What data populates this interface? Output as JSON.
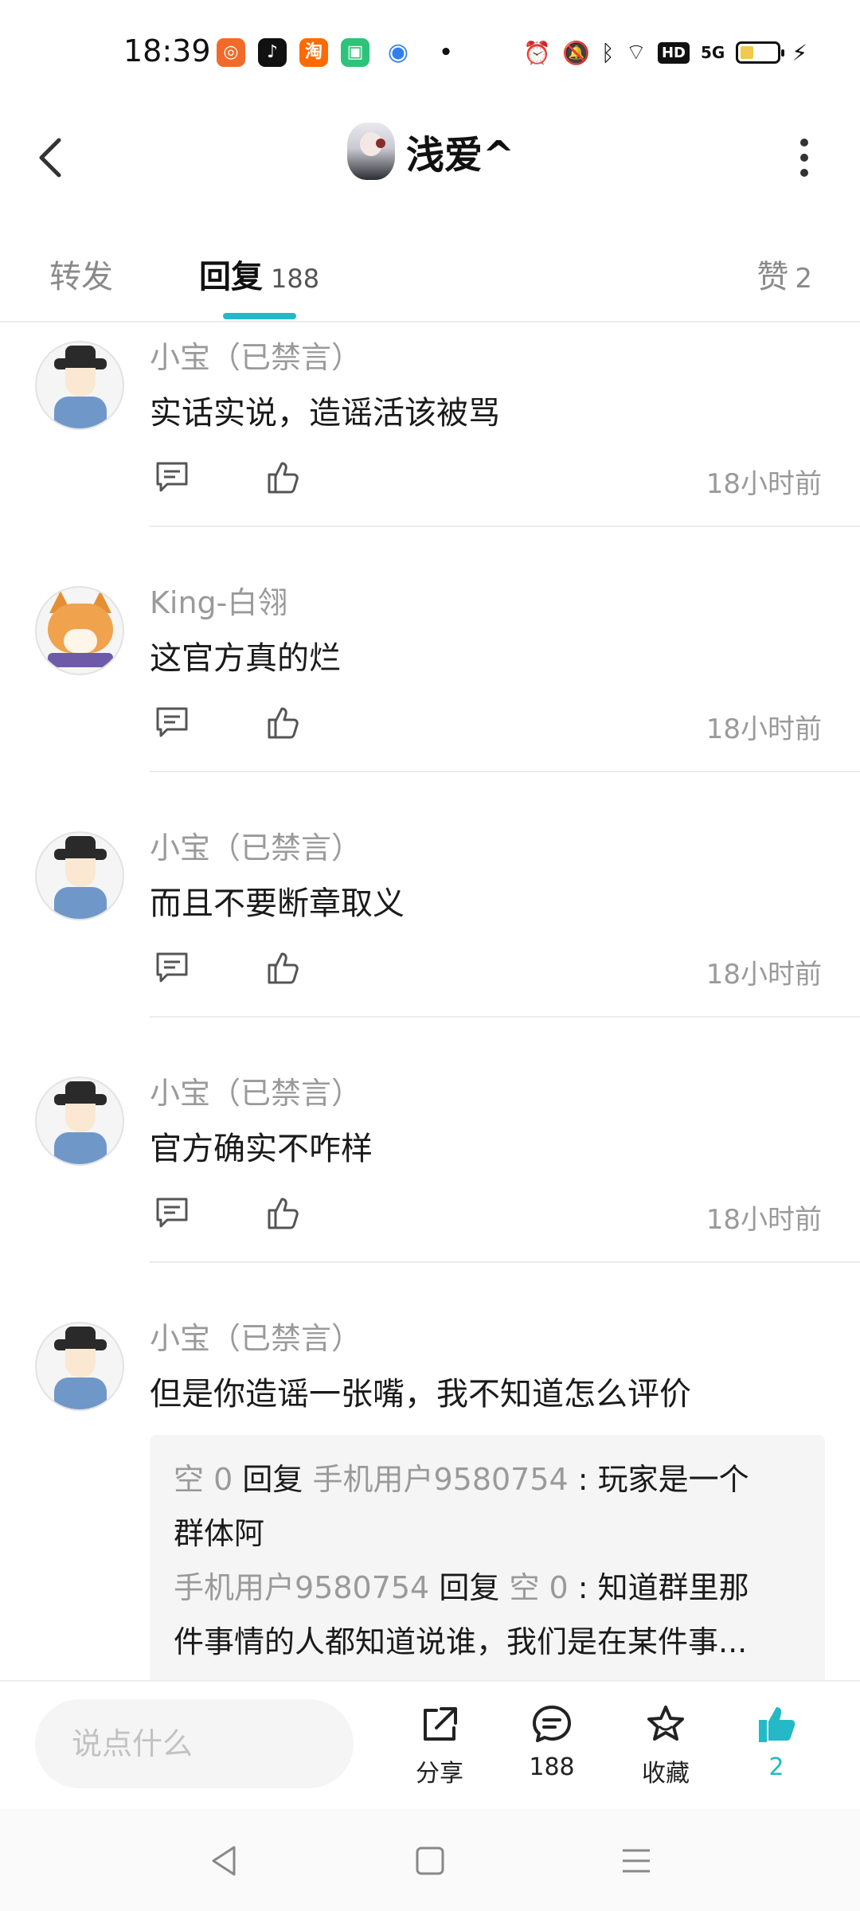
{
  "status_bar": {
    "time": "18:39",
    "apps": [
      "chat-icon",
      "tiktok-icon",
      "taobao-icon",
      "mall-icon",
      "browser-icon"
    ],
    "icons": [
      "alarm-icon",
      "mute-icon",
      "bluetooth-icon",
      "wifi-icon",
      "hd-icon",
      "signal-5g-icon",
      "battery-icon",
      "charging-icon"
    ],
    "hd_label": "HD",
    "net_label": "5G"
  },
  "header": {
    "title": "浅爱^"
  },
  "tabs": {
    "forward": "转发",
    "reply": "回复",
    "reply_count": "188",
    "like": "赞",
    "like_count": "2",
    "accent_color": "#23b9c6"
  },
  "comments": [
    {
      "author": "小宝（已禁言）",
      "text": "实话实说，造谣活该被骂",
      "time": "18小时前"
    },
    {
      "author": "King-白翎",
      "text": "这官方真的烂",
      "time": "18小时前"
    },
    {
      "author": "小宝（已禁言）",
      "text": "而且不要断章取义",
      "time": "18小时前"
    },
    {
      "author": "小宝（已禁言）",
      "text": "官方确实不咋样",
      "time": "18小时前"
    },
    {
      "author": "小宝（已禁言）",
      "text": "但是你造谣一张嘴，我不知道怎么评价",
      "sub_replies": [
        {
          "from": "空 0",
          "verb": "回复",
          "to": "手机用户9580754",
          "line1": " : 玩家是一个",
          "line2": "群体阿"
        },
        {
          "from": "手机用户9580754",
          "verb": "回复",
          "to": "空 0",
          "line1": " : 知道群里那",
          "line2": "件事情的人都知道说谁，我们是在某件事..."
        }
      ]
    }
  ],
  "bottom_bar": {
    "input_placeholder": "说点什么",
    "share_label": "分享",
    "comment_count": "188",
    "favorite_label": "收藏",
    "like_count": "2"
  }
}
